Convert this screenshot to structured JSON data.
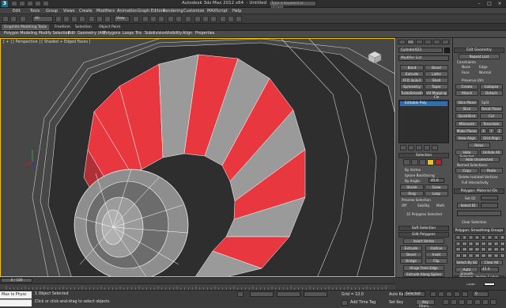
{
  "app": {
    "title": "Autodesk 3ds Max 2012 x64",
    "subtitle": "Untitled",
    "search_placeholder": "Type a keyword or phrase",
    "logo_text": "3"
  },
  "menu": [
    "Edit",
    "Tools",
    "Group",
    "Views",
    "Create",
    "Modifiers",
    "Animation",
    "Graph Editors",
    "Rendering",
    "Customize",
    "MAXScript",
    "Help"
  ],
  "toolbar": {
    "selection_filter": "All",
    "view_dropdown": "View"
  },
  "ribbon": {
    "tabs": [
      "Graphite Modeling Tools",
      "Freeform",
      "Selection",
      "Object Paint"
    ],
    "subtabs": [
      "Polygon Modeling",
      "Modify Selection",
      "Edit",
      "Geometry (All)",
      "Polygons",
      "Loops",
      "Tris",
      "Subdivision",
      "Visibility",
      "Align",
      "Properties"
    ]
  },
  "viewport": {
    "label": "[ + ] [ Perspective ] [ Shaded + Edged Faces ]"
  },
  "modify_panel": {
    "object_name": "Cylinder023",
    "modifier_list": "Modifier List",
    "buttons": [
      [
        "Bend",
        "Bevel"
      ],
      [
        "Extrude",
        "Lathe"
      ],
      [
        "FFD 3x3x3",
        "Shell"
      ],
      [
        "Symmetry",
        "Taper"
      ],
      [
        "TurboSmooth",
        "UV Mapping Cle"
      ]
    ],
    "stack_item": "Editable Poly",
    "selection": {
      "title": "Selection",
      "by_vertex": "By Vertex",
      "ignore_backfacing": "Ignore Backfacing",
      "by_angle": "By Angle:",
      "angle_value": "45.0",
      "shrink": "Shrink",
      "grow": "Grow",
      "ring": "Ring",
      "loop": "Loop",
      "preview": "Preview Selection",
      "preview_opts": [
        "Off",
        "SubObj",
        "Multi"
      ],
      "status": "32 Polygons Selected"
    },
    "soft_selection": "Soft Selection",
    "edit_polygons": {
      "title": "Edit Polygons",
      "insert_vertex": "Insert Vertex",
      "rows": [
        [
          "Extrude",
          "Outline"
        ],
        [
          "Bevel",
          "Inset"
        ],
        [
          "Bridge",
          "Flip"
        ]
      ],
      "hinge": "Hinge From Edge",
      "extrude_spline": "Extrude Along Spline",
      "edit_tri": "Edit Triangulation",
      "retri": "Retriangulate",
      "turn": "Turn"
    }
  },
  "right_panel": {
    "edit_geometry": "Edit Geometry",
    "repeat_last": "Repeat Last",
    "constraints": "Constraints",
    "constraint_opts": [
      "None",
      "Edge",
      "Face",
      "Normal"
    ],
    "preserve_uvs": "Preserve UVs",
    "create": "Create",
    "collapse": "Collapse",
    "attach": "Attach",
    "detach": "Detach",
    "slice_plane": "Slice Plane",
    "split": "Split",
    "slice": "Slice",
    "reset_plane": "Reset Plane",
    "quickslice": "QuickSlice",
    "cut": "Cut",
    "msmooth": "MSmooth",
    "tessellate": "Tessellate",
    "make_planar": "Make Planar",
    "xyz": [
      "X",
      "Y",
      "Z"
    ],
    "view_align": "View Align",
    "grid_align": "Grid Align",
    "relax": "Relax",
    "hide_selected": "Hide Selected",
    "unhide_all": "Unhide All",
    "hide_unselected": "Hide Unselected",
    "named_selections": "Named Selections:",
    "copy": "Copy",
    "paste": "Paste",
    "delete_isolated": "Delete Isolated Vertices",
    "full_interactivity": "Full Interactivity",
    "material_ids": "Polygon: Material IDs",
    "set_id": "Set ID:",
    "select_id": "Select ID",
    "clear_selection": "Clear Selection",
    "smoothing_groups": "Polygon: Smoothing Groups",
    "sg_numbers": [
      "1",
      "2",
      "3",
      "4",
      "5",
      "6",
      "7",
      "8",
      "9",
      "10",
      "11",
      "12",
      "13",
      "14",
      "15",
      "16",
      "17",
      "18",
      "19",
      "20",
      "21",
      "22",
      "23",
      "24",
      "25",
      "26",
      "27",
      "28",
      "29",
      "30",
      "31",
      "32"
    ],
    "select_by_sg": "Select By SG",
    "clear_all": "Clear All",
    "auto_smooth": "Auto Smooth",
    "auto_smooth_value": "45.0",
    "vertex_colors": "Polygon: Vertex Colors",
    "color": "Color:"
  },
  "timeline": {
    "frame": "0 / 100"
  },
  "status": {
    "maxscript_line": "Max to Physc",
    "selected": "1 Object Selected",
    "prompt": "Click or click-and-drag to select objects",
    "grid": "Grid = 10.0",
    "auto_key": "Auto Key",
    "selected_dropdown": "Selected",
    "set_key": "Set Key",
    "key_filters": "Key Filters...",
    "add_time_tag": "Add Time Tag",
    "frame_field": "0"
  },
  "colors": {
    "red_face": "#e8373f",
    "gray_face": "#9a9a9a",
    "dark_face": "#2a2a2a",
    "wire": "#ffffff",
    "selected_border": "#f5c200",
    "auto_key": "#b02020"
  }
}
